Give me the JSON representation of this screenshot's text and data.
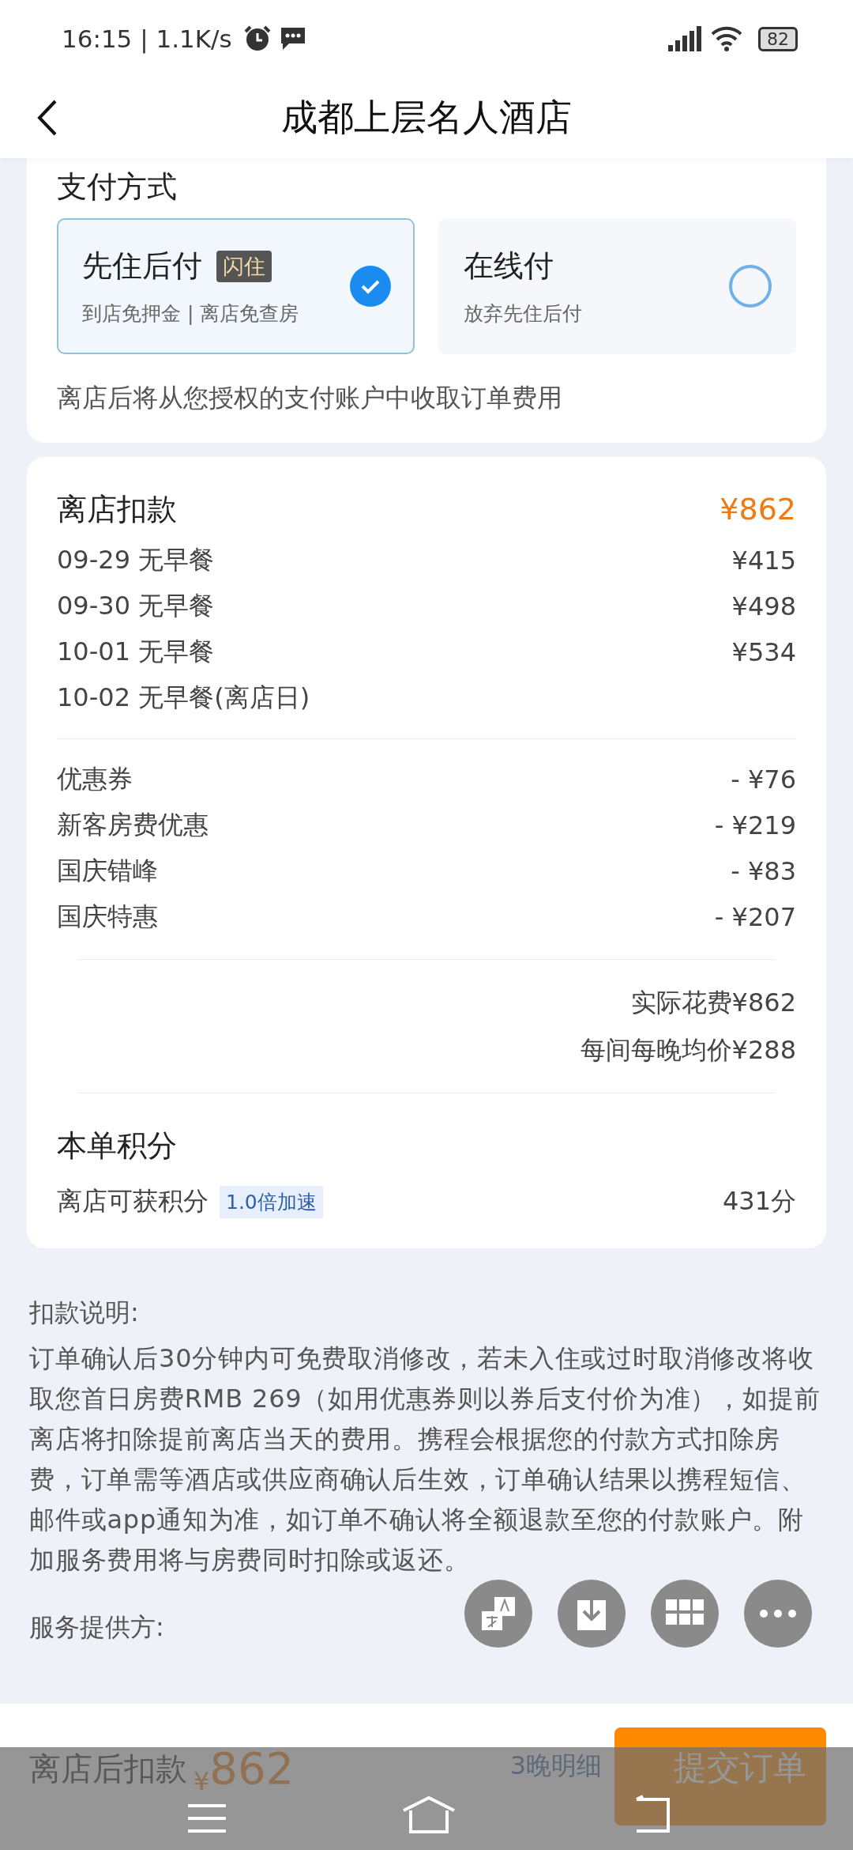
{
  "status_bar": {
    "time": "16:15 | 1.1K/s",
    "battery": "82"
  },
  "header": {
    "title": "成都上层名人酒店"
  },
  "payment": {
    "title": "支付方式",
    "options": [
      {
        "name": "先住后付",
        "badge": "闪住",
        "subtitle": "到店免押金 | 离店免查房",
        "selected": true
      },
      {
        "name": "在线付",
        "subtitle": "放弃先住后付",
        "selected": false
      }
    ],
    "note": "离店后将从您授权的支付账户中收取订单费用"
  },
  "charges": {
    "title": "离店扣款",
    "total": "¥862",
    "nights": [
      {
        "label": "09-29 无早餐",
        "price": "¥415"
      },
      {
        "label": "09-30 无早餐",
        "price": "¥498"
      },
      {
        "label": "10-01 无早餐",
        "price": "¥534"
      },
      {
        "label": "10-02 无早餐(离店日)"
      }
    ],
    "discounts": [
      {
        "label": "优惠券",
        "amount": "- ¥76"
      },
      {
        "label": "新客房费优惠",
        "amount": "- ¥219"
      },
      {
        "label": "国庆错峰",
        "amount": "- ¥83"
      },
      {
        "label": "国庆特惠",
        "amount": "- ¥207"
      }
    ],
    "actual": "实际花费¥862",
    "average": "每间每晚均价¥288"
  },
  "points": {
    "title": "本单积分",
    "label": "离店可获积分",
    "badge": "1.0倍加速",
    "value": "431分"
  },
  "deduction_note": {
    "title": "扣款说明:",
    "text": "订单确认后30分钟内可免费取消修改，若未入住或过时取消修改将收取您首日房费RMB 269（如用优惠券则以券后支付价为准），如提前离店将扣除提前离店当天的费用。携程会根据您的付款方式扣除房费，订单需等酒店或供应商确认后生效，订单确认结果以携程短信、邮件或app通知为准，如订单不确认将全额退款至您的付款账户。附加服务费用将与房费同时扣除或返还。"
  },
  "provider": {
    "title": "服务提供方:"
  },
  "bottom_bar": {
    "label": "离店后扣款",
    "currency": "¥",
    "amount": "862",
    "details": "3晚明细",
    "submit": "提交订单"
  }
}
